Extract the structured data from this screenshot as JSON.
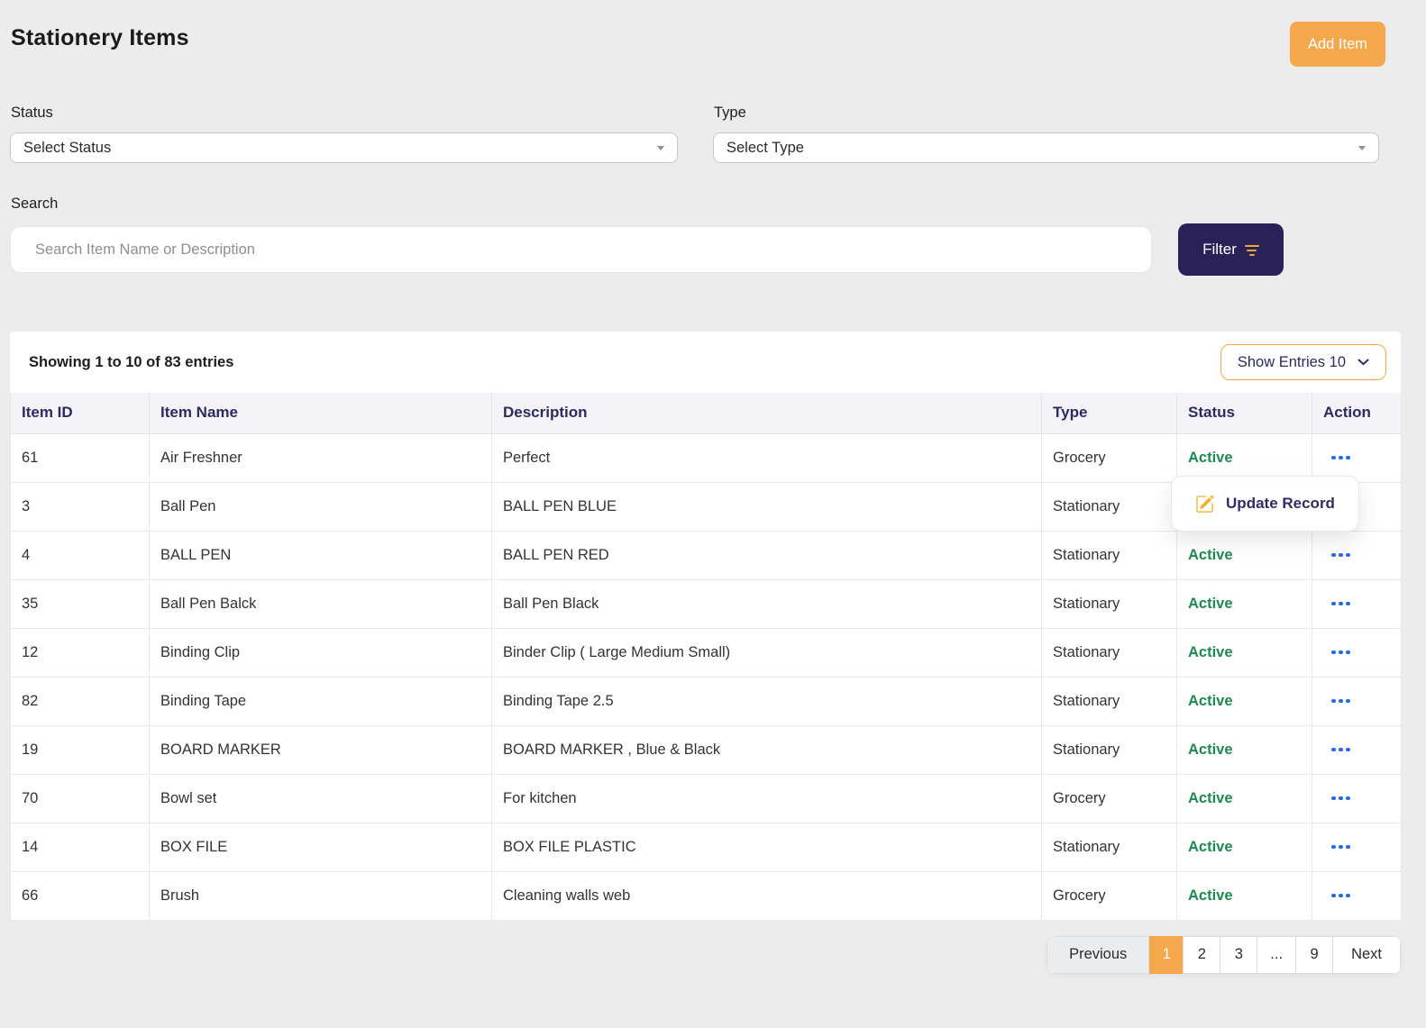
{
  "page": {
    "title": "Stationery Items"
  },
  "header": {
    "add_item_label": "Add Item"
  },
  "filters": {
    "status": {
      "label": "Status",
      "selected": "Select Status"
    },
    "type": {
      "label": "Type",
      "selected": "Select Type"
    },
    "search": {
      "label": "Search",
      "placeholder": "Search Item Name or Description"
    },
    "filter_button_label": "Filter"
  },
  "table": {
    "summary": "Showing 1 to 10 of 83 entries",
    "show_entries_label": "Show Entries 10",
    "columns": [
      "Item ID",
      "Item Name",
      "Description",
      "Type",
      "Status",
      "Action"
    ],
    "rows": [
      {
        "id": "61",
        "name": "Air Freshner",
        "description": "Perfect",
        "type": "Grocery",
        "status": "Active"
      },
      {
        "id": "3",
        "name": "Ball Pen",
        "description": "BALL PEN BLUE",
        "type": "Stationary",
        "status": ""
      },
      {
        "id": "4",
        "name": "BALL PEN",
        "description": "BALL PEN RED",
        "type": "Stationary",
        "status": "Active"
      },
      {
        "id": "35",
        "name": "Ball Pen Balck",
        "description": "Ball Pen Black",
        "type": "Stationary",
        "status": "Active"
      },
      {
        "id": "12",
        "name": "Binding Clip",
        "description": "Binder Clip ( Large Medium Small)",
        "type": "Stationary",
        "status": "Active"
      },
      {
        "id": "82",
        "name": "Binding Tape",
        "description": "Binding Tape 2.5",
        "type": "Stationary",
        "status": "Active"
      },
      {
        "id": "19",
        "name": "BOARD MARKER",
        "description": "BOARD MARKER , Blue & Black",
        "type": "Stationary",
        "status": "Active"
      },
      {
        "id": "70",
        "name": "Bowl set",
        "description": "For kitchen",
        "type": "Grocery",
        "status": "Active"
      },
      {
        "id": "14",
        "name": "BOX FILE",
        "description": "BOX FILE PLASTIC",
        "type": "Stationary",
        "status": "Active"
      },
      {
        "id": "66",
        "name": "Brush",
        "description": "Cleaning walls web",
        "type": "Grocery",
        "status": "Active"
      }
    ]
  },
  "popup": {
    "update_record_label": "Update Record"
  },
  "pagination": {
    "previous_label": "Previous",
    "pages": [
      "1",
      "2",
      "3",
      "...",
      "9"
    ],
    "active_page": "1",
    "next_label": "Next"
  },
  "colors": {
    "accent_orange": "#F5A84B",
    "filter_navy": "#2A2158",
    "heading_navy": "#2D2A62",
    "active_green": "#1C8C4E",
    "action_blue": "#2969E8",
    "edit_icon_yellow": "#F0B429",
    "page_background": "#ECECEC"
  },
  "icons": {
    "filter_button": "filter-lines-icon",
    "show_entries": "chevron-down-icon",
    "selects": "caret-down-icon",
    "row_action": "ellipsis-icon",
    "popup": "edit-pencil-square-icon"
  }
}
